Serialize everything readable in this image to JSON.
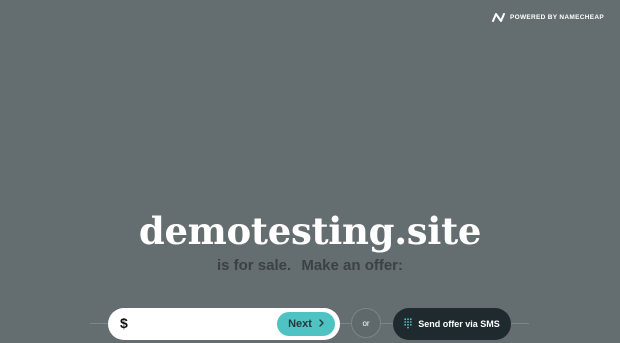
{
  "header": {
    "powered_by": "POWERED BY NAMECHEAP",
    "brand_icon": "namecheap-logo-icon"
  },
  "main": {
    "domain_name": "demotesting.site",
    "for_sale_text": "is for sale.",
    "offer_prompt": "Make an offer:"
  },
  "offer_form": {
    "currency_symbol": "$",
    "amount_value": "",
    "next_label": "Next",
    "next_icon": "chevron-right-icon"
  },
  "divider": {
    "or_label": "or"
  },
  "sms": {
    "label": "Send offer via SMS",
    "icon": "keypad-icon"
  },
  "colors": {
    "background": "#646d6f",
    "accent": "#4fc3c3",
    "dark_button": "#1f2a2e"
  }
}
